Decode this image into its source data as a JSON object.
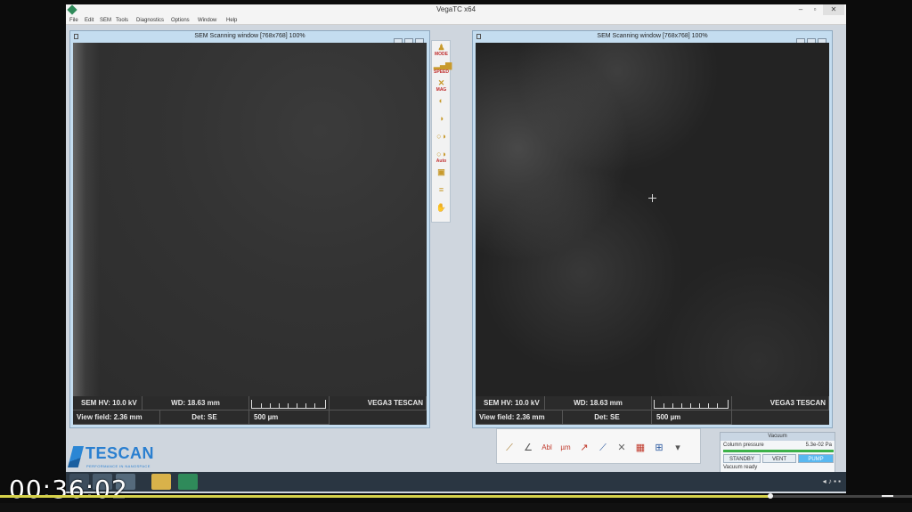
{
  "app": {
    "title": "VegaTC x64",
    "menu": [
      "File",
      "Edit",
      "SEM",
      "Tools",
      "Diagnostics",
      "Options",
      "Window",
      "Help"
    ],
    "window_controls": [
      "–",
      "▫",
      "✕"
    ]
  },
  "scan_windows": [
    {
      "title": "SEM Scanning window [768x768] 100%",
      "hv": "SEM HV: 10.0 kV",
      "wd": "WD: 18.63 mm",
      "view_field": "View field: 2.36 mm",
      "det": "Det: SE",
      "scale": "500 µm",
      "brand": "VEGA3 TESCAN"
    },
    {
      "title": "SEM Scanning window [768x768] 100%",
      "hv": "SEM HV: 10.0 kV",
      "wd": "WD: 18.63 mm",
      "view_field": "View field: 2.36 mm",
      "det": "Det: SE",
      "scale": "500 µm",
      "brand": "VEGA3 TESCAN"
    }
  ],
  "vertical_toolbar": [
    {
      "icon": "mode-icon",
      "label": "MODE"
    },
    {
      "icon": "speed-icon",
      "label": "SPEED"
    },
    {
      "icon": "magnification-icon",
      "label": "MAG"
    },
    {
      "icon": "focus-icon",
      "label": ""
    },
    {
      "icon": "stigmator-icon",
      "label": ""
    },
    {
      "icon": "brightness-contrast-icon",
      "label": ""
    },
    {
      "icon": "auto-brightness-contrast-icon",
      "label": "Auto"
    },
    {
      "icon": "wobbler-icon",
      "label": ""
    },
    {
      "icon": "beam-settings-icon",
      "label": ""
    },
    {
      "icon": "hand-tool-icon",
      "label": ""
    }
  ],
  "palette_tools": [
    {
      "icon": "ruler-icon",
      "glyph": "⟋"
    },
    {
      "icon": "angle-icon",
      "glyph": "∠"
    },
    {
      "icon": "text-tool-icon",
      "glyph": "Abl"
    },
    {
      "icon": "scale-label-icon",
      "glyph": "µm"
    },
    {
      "icon": "arrow-tool-icon",
      "glyph": "↗"
    },
    {
      "icon": "line-tool-icon",
      "glyph": "⟋"
    },
    {
      "icon": "delete-tool-icon",
      "glyph": "✕"
    },
    {
      "icon": "grid-tool-icon",
      "glyph": "▦"
    },
    {
      "icon": "image-overlay-icon",
      "glyph": "⊞"
    },
    {
      "icon": "dropdown-icon",
      "glyph": "▾"
    }
  ],
  "vacuum": {
    "header": "Vacuum",
    "pressure_label": "Column pressure",
    "pressure_value": "5.3e-02 Pa",
    "buttons": {
      "standby": "STANDBY",
      "vent": "VENT",
      "pump": "PUMP"
    },
    "status": "Vacuum ready",
    "bar_level": 1.0,
    "bar_color": "#3cb24a"
  },
  "logo": {
    "word": "TESCAN",
    "tagline": "PERFORMANCE IN NANOSPACE"
  },
  "taskbar": {
    "icons": [
      "start-icon",
      "explorer-icon",
      "browser-icon",
      "folder-icon",
      "vegatc-icon"
    ],
    "tray": "◂ ♪ ▪ ▪"
  },
  "player": {
    "timestamp": "00:36:02",
    "progress": 0.845,
    "progress_color": "#d6d24a",
    "volume_level": 0.55
  }
}
